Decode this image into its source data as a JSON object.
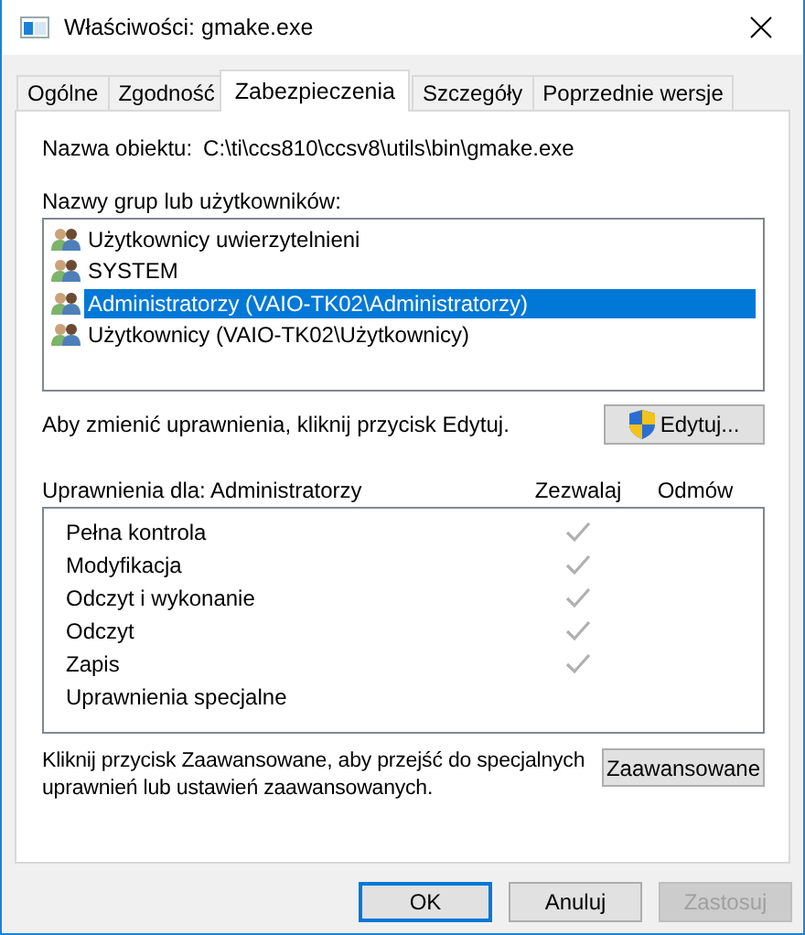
{
  "window": {
    "title": "Właściwości: gmake.exe"
  },
  "tabs": [
    {
      "label": "Ogólne",
      "selected": false
    },
    {
      "label": "Zgodność",
      "selected": false
    },
    {
      "label": "Zabezpieczenia",
      "selected": true
    },
    {
      "label": "Szczegóły",
      "selected": false
    },
    {
      "label": "Poprzednie wersje",
      "selected": false
    }
  ],
  "object_name": {
    "label": "Nazwa obiektu:",
    "value": "C:\\ti\\ccs810\\ccsv8\\utils\\bin\\gmake.exe"
  },
  "groups": {
    "label": "Nazwy grup lub użytkowników:",
    "items": [
      {
        "name": "Użytkownicy uwierzytelnieni",
        "selected": false
      },
      {
        "name": "SYSTEM",
        "selected": false
      },
      {
        "name": "Administratorzy (VAIO-TK02\\Administratorzy)",
        "selected": true
      },
      {
        "name": "Użytkownicy (VAIO-TK02\\Użytkownicy)",
        "selected": false
      }
    ]
  },
  "edit": {
    "hint": "Aby zmienić uprawnienia, kliknij przycisk Edytuj.",
    "button": "Edytuj..."
  },
  "permissions": {
    "label": "Uprawnienia dla: Administratorzy",
    "columns": [
      "Zezwalaj",
      "Odmów"
    ],
    "rows": [
      {
        "name": "Pełna kontrola",
        "allow": true,
        "deny": false
      },
      {
        "name": "Modyfikacja",
        "allow": true,
        "deny": false
      },
      {
        "name": "Odczyt i wykonanie",
        "allow": true,
        "deny": false
      },
      {
        "name": "Odczyt",
        "allow": true,
        "deny": false
      },
      {
        "name": "Zapis",
        "allow": true,
        "deny": false
      },
      {
        "name": "Uprawnienia specjalne",
        "allow": false,
        "deny": false
      }
    ]
  },
  "advanced": {
    "hint": "Kliknij przycisk Zaawansowane, aby przejść do specjalnych uprawnień lub ustawień zaawansowanych.",
    "button": "Zaawansowane"
  },
  "buttons": [
    {
      "label": "OK",
      "default": true,
      "disabled": false
    },
    {
      "label": "Anuluj",
      "default": false,
      "disabled": false
    },
    {
      "label": "Zastosuj",
      "default": false,
      "disabled": true
    }
  ]
}
